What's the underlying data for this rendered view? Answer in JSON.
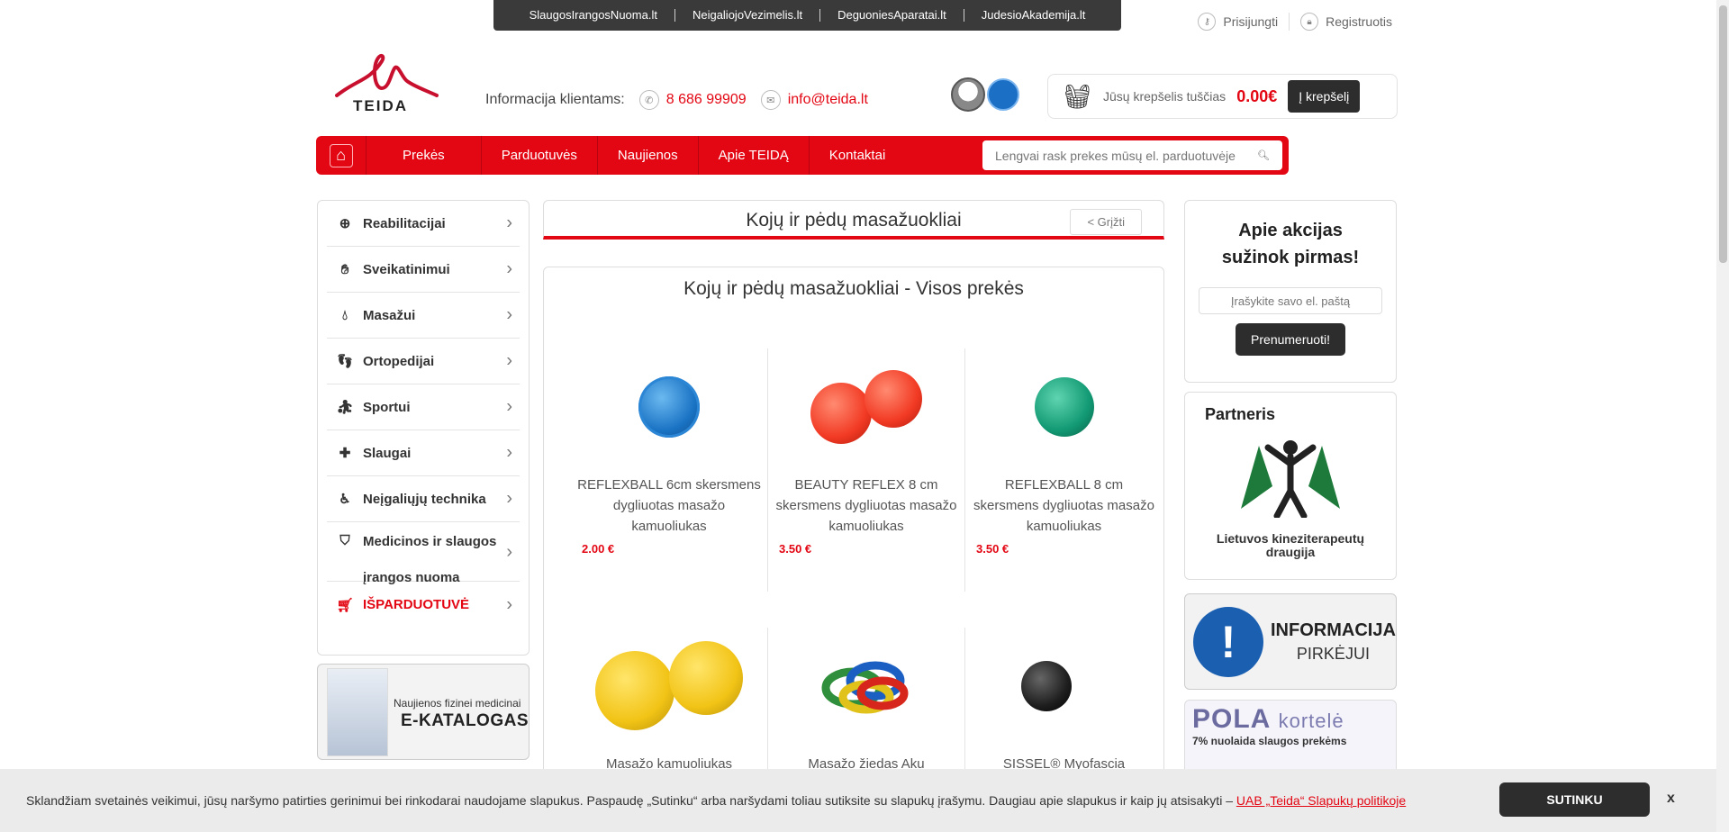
{
  "topbar": {
    "links": [
      "SlaugosIrangosNuoma.lt",
      "NeigaliojoVezimelis.lt",
      "DeguoniesAparatai.lt",
      "JudesioAkademija.lt"
    ]
  },
  "account": {
    "login": "Prisijungti",
    "register": "Registruotis"
  },
  "logo": {
    "text": "TEIDA"
  },
  "contact": {
    "label": "Informacija klientams:",
    "phone": "8 686 99909",
    "email": "info@teida.lt"
  },
  "cart": {
    "status": "Jūsų krepšelis tuščias",
    "total": "0.00€",
    "button": "Į krepšelį"
  },
  "nav": {
    "items": [
      "Prekės",
      "Parduotuvės",
      "Naujienos",
      "Apie TEIDĄ",
      "Kontaktai"
    ],
    "search_placeholder": "Lengvai rask prekes mūsų el. parduotuvėje"
  },
  "sidebar": {
    "categories": [
      {
        "label": "Reabilitacijai",
        "icon": "plus-heart-icon"
      },
      {
        "label": "Sveikatinimui",
        "icon": "hand-icon"
      },
      {
        "label": "Masažui",
        "icon": "drop-icon"
      },
      {
        "label": "Ortopedijai",
        "icon": "feet-icon"
      },
      {
        "label": "Sportui",
        "icon": "fitness-icon"
      },
      {
        "label": "Slaugai",
        "icon": "plus-circle-icon"
      },
      {
        "label": "Neįgaliųjų technika",
        "icon": "wheelchair-icon"
      },
      {
        "label": "Medicinos ir slaugos",
        "label2": "įrangos nuoma",
        "icon": "n-shield-icon"
      },
      {
        "label": "IŠPARDUOTUVĖ",
        "icon": "cart-icon"
      }
    ],
    "catalog": {
      "line1": "Naujienos fizinei medicinai",
      "line2": "E-KATALOGAS"
    }
  },
  "main": {
    "title": "Kojų ir pėdų masažuokliai",
    "back": "< Grįžti",
    "subtitle": "Kojų ir pėdų masažuokliai - Visos prekės",
    "products": [
      {
        "name": "REFLEXBALL 6cm skersmens dygliuotas masažo kamuoliukas",
        "price": "2.00 €",
        "color": "#1a73c4"
      },
      {
        "name": "BEAUTY REFLEX 8 cm skersmens dygliuotas masažo kamuoliukas",
        "price": "3.50 €",
        "color": "#f23a24"
      },
      {
        "name": "REFLEXBALL 8 cm skersmens dygliuotas masažo kamuoliukas",
        "price": "3.50 €",
        "color": "#129a74"
      },
      {
        "name": "Masažo kamuoliukas",
        "price": "",
        "color": "#f2c417"
      },
      {
        "name": "Masažo žiedas Aku",
        "price": "",
        "color": "#2f8f3c"
      },
      {
        "name": "SISSEL® Myofascia",
        "price": "",
        "color": "#1e1e1e"
      }
    ]
  },
  "right": {
    "newsletter": {
      "heading1": "Apie akcijas",
      "heading2": "sužinok pirmas!",
      "placeholder": "Įrašykite savo el. paštą",
      "button": "Prenumeruoti!"
    },
    "partner": {
      "heading": "Partneris",
      "caption1": "Lietuvos kineziterapeutų",
      "caption2": "draugija"
    },
    "info": {
      "line1": "INFORMACIJA",
      "line2": "PIRKĖJUI"
    },
    "pola": {
      "title": "POLA",
      "title2": "kortelė",
      "text": "7% nuolaida slaugos prekėms"
    }
  },
  "cookie": {
    "text": "Sklandžiam svetainės veikimui, jūsų naršymo patirties gerinimui bei rinkodarai naudojame slapukus. Paspaudę „Sutinku“ arba naršydami toliau sutiksite su slapukų įrašymu. Daugiau apie slapukus ir kaip jų atsisakyti –",
    "link": "UAB „Teida“ Slapukų politikoje",
    "accept": "SUTINKU",
    "close": "x"
  }
}
